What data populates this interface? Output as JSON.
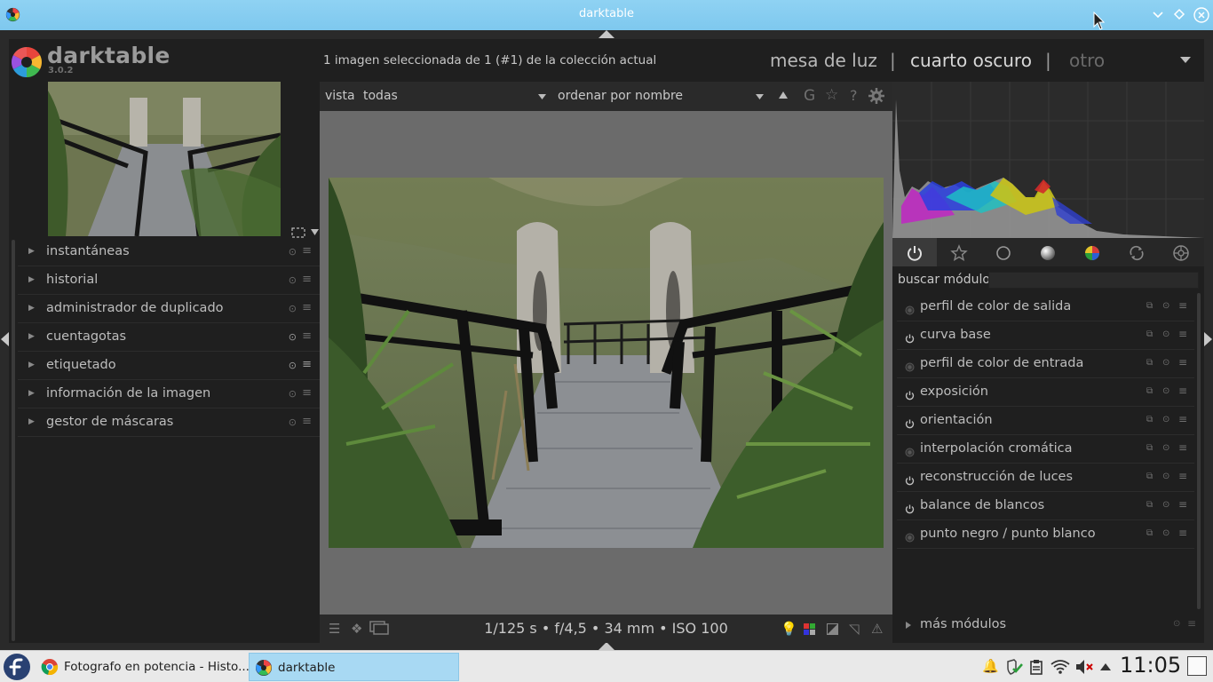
{
  "window": {
    "title": "darktable"
  },
  "header": {
    "logo_text": "darktable",
    "version": "3.0.2",
    "collection_info": "1 imagen seleccionada de 1 (#1) de la colección actual",
    "views": {
      "lighttable": "mesa de luz",
      "darkroom": "cuarto oscuro",
      "other": "otro",
      "separator": "|"
    }
  },
  "filterbar": {
    "view_label": "vista",
    "view_value": "todas",
    "sort_label": "ordenar por",
    "sort_value": "nombre"
  },
  "left_panel": {
    "modules": [
      {
        "label": "instantáneas"
      },
      {
        "label": "historial"
      },
      {
        "label": "administrador de duplicado"
      },
      {
        "label": "cuentagotas"
      },
      {
        "label": "etiquetado"
      },
      {
        "label": "información de la imagen"
      },
      {
        "label": "gestor de máscaras"
      }
    ]
  },
  "center": {
    "exif": "1/125 s • f/4,5 • 34 mm • ISO 100"
  },
  "right_panel": {
    "search_label": "buscar módulo",
    "search_value": "",
    "group_tabs": [
      "power-icon",
      "star-icon",
      "circle-icon",
      "tone-icon",
      "color-icon",
      "correct-icon",
      "effect-icon"
    ],
    "modules": [
      {
        "label": "perfil de color de salida",
        "enabled": false
      },
      {
        "label": "curva base",
        "enabled": true
      },
      {
        "label": "perfil de color de entrada",
        "enabled": false
      },
      {
        "label": "exposición",
        "enabled": true
      },
      {
        "label": "orientación",
        "enabled": true
      },
      {
        "label": "interpolación cromática",
        "enabled": false
      },
      {
        "label": "reconstrucción de luces",
        "enabled": true
      },
      {
        "label": "balance de blancos",
        "enabled": true
      },
      {
        "label": "punto negro / punto blanco",
        "enabled": false
      }
    ],
    "more_modules": "más módulos"
  },
  "taskbar": {
    "tasks": [
      {
        "label": "Fotografo en potencia - Histo...",
        "icon": "chrome-icon"
      },
      {
        "label": "darktable",
        "icon": "darktable-icon"
      }
    ],
    "clock": "11:05"
  },
  "colors": {
    "titlebar": "#8fd2f3",
    "panel_bg": "#1f1f1f",
    "center_bg": "#6b6b6b",
    "active_task": "#a8d9f3"
  }
}
